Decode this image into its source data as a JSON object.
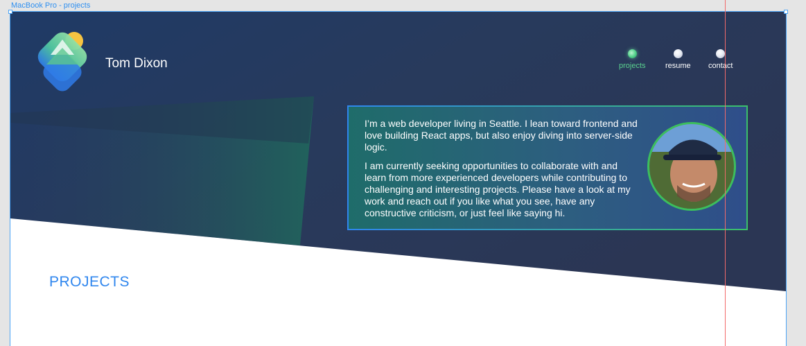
{
  "editor": {
    "frame_label": "MacBook Pro - projects"
  },
  "header": {
    "site_name": "Tom Dixon",
    "logo_icon": "mountain-sun-logo-icon"
  },
  "nav": {
    "items": [
      {
        "label": "projects",
        "active": true
      },
      {
        "label": "resume",
        "active": false
      },
      {
        "label": "contact",
        "active": false
      }
    ]
  },
  "about": {
    "paragraph1": "I’m a web developer living in Seattle. I lean toward frontend and love building React apps, but also enjoy diving into server-side logic.",
    "paragraph2": "I am currently seeking opportunities to collaborate with and learn from more experienced developers while contributing to challenging and interesting projects. Please have a look at my work and reach out if you like what you see, have any constructive criticism, or just feel like saying hi.",
    "photo_icon": "profile-photo"
  },
  "projects": {
    "heading": "PROJECTS"
  },
  "colors": {
    "hero_dark": "#273552",
    "accent_blue": "#2f86ee",
    "accent_green": "#3cbf5d",
    "nav_active": "#5ad28f"
  }
}
